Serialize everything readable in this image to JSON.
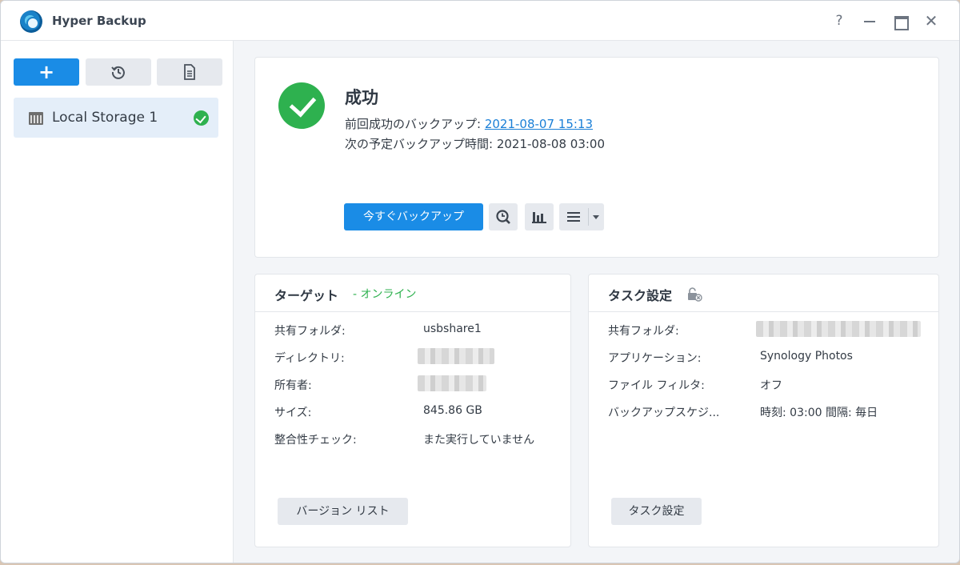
{
  "window": {
    "title": "Hyper Backup",
    "controls": {
      "help": "?",
      "close": "✕"
    }
  },
  "sidebar": {
    "add_label": "+",
    "tasks": [
      {
        "name": "Local Storage 1",
        "status": "success"
      }
    ]
  },
  "status": {
    "title": "成功",
    "last_success_label": "前回成功のバックアップ:",
    "last_success_value": "2021-08-07 15:13",
    "next_label": "次の予定バックアップ時間:",
    "next_value": "2021-08-08 03:00",
    "backup_now_label": "今すぐバックアップ"
  },
  "target": {
    "title": "ターゲット",
    "status_text": "- オンライン",
    "rows": [
      {
        "label": "共有フォルダ:",
        "value": "usbshare1"
      },
      {
        "label": "ディレクトリ:",
        "value": ""
      },
      {
        "label": "所有者:",
        "value": ""
      },
      {
        "label": "サイズ:",
        "value": "845.86 GB"
      },
      {
        "label": "整合性チェック:",
        "value": "また実行していません"
      }
    ],
    "button_label": "バージョン リスト"
  },
  "task_settings": {
    "title": "タスク設定",
    "rows": [
      {
        "label": "共有フォルダ:",
        "value": ""
      },
      {
        "label": "アプリケーション:",
        "value": "Synology Photos"
      },
      {
        "label": "ファイル フィルタ:",
        "value": "オフ"
      },
      {
        "label": "バックアップスケジ...",
        "value": "時刻: 03:00 間隔: 毎日"
      }
    ],
    "button_label": "タスク設定"
  },
  "colors": {
    "accent": "#1a8ce6",
    "success": "#2eb14f",
    "link": "#1a7fd7"
  }
}
